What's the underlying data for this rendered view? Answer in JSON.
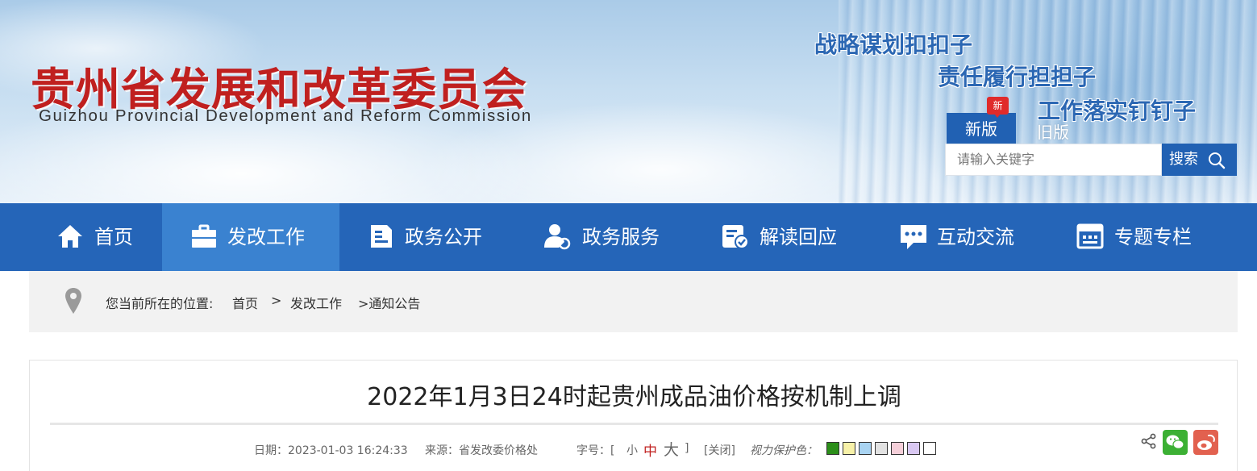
{
  "banner": {
    "org_name_cn": "贵州省发展和改革委员会",
    "org_name_en": "Guizhou Provincial Development and Reform Commission",
    "slogans": [
      "战略谋划扣扣子",
      "责任履行担担子",
      "工作落实钉钉子"
    ],
    "badge_new": "新",
    "version_new": "新版",
    "version_old": "旧版"
  },
  "search": {
    "placeholder": "请输入关键字",
    "button_label": "搜索"
  },
  "nav": {
    "items": [
      {
        "label": "首页",
        "icon": "home-icon"
      },
      {
        "label": "发改工作",
        "icon": "briefcase-icon",
        "active": true
      },
      {
        "label": "政务公开",
        "icon": "document-icon"
      },
      {
        "label": "政务服务",
        "icon": "user-service-icon"
      },
      {
        "label": "解读回应",
        "icon": "checklist-icon"
      },
      {
        "label": "互动交流",
        "icon": "chat-icon"
      },
      {
        "label": "专题专栏",
        "icon": "column-icon"
      }
    ]
  },
  "breadcrumb": {
    "prefix": "您当前所在的位置:",
    "items": [
      "首页",
      ">",
      "发改工作",
      ">通知公告"
    ]
  },
  "article": {
    "title": "2022年1月3日24时起贵州成品油价格按机制上调",
    "date_label": "日期：2023-01-03 16:24:33",
    "source_label": "来源：省发改委价格处",
    "font_size_label": "字号：[",
    "font_small": "小",
    "font_medium": "中",
    "font_large": "大",
    "font_close_bracket": "]",
    "close_label": "[关闭]",
    "eye_care_label": "视力保护色：",
    "eye_care_colors": [
      "#2c8f1a",
      "#f7f1a8",
      "#a9d4f2",
      "#e2e2e2",
      "#f5cfd9",
      "#d9c8f2",
      "#ffffff"
    ]
  },
  "colors": {
    "brand_blue": "#2565b8",
    "nav_active": "#3a82d0",
    "logo_red": "#c0201f",
    "font_medium_red": "#c0201f",
    "wechat_green": "#3cb034",
    "weibo_red": "#e2614f"
  }
}
